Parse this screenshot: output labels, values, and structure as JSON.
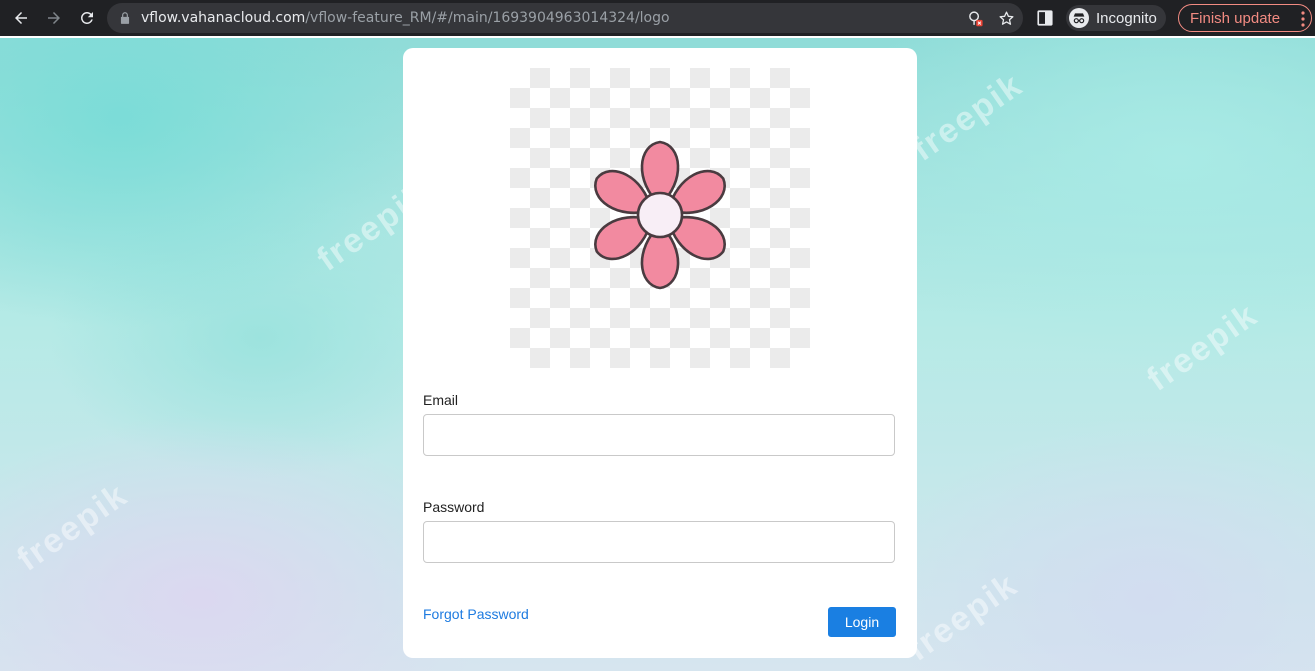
{
  "browser": {
    "url_host": "vflow.vahanacloud.com",
    "url_path": "/vflow-feature_RM/#/main/1693904963014324/logo",
    "profile_label": "Incognito",
    "update_label": "Finish update"
  },
  "background": {
    "watermark_text": "freepik"
  },
  "login": {
    "email_label": "Email",
    "email_value": "",
    "password_label": "Password",
    "password_value": "",
    "forgot_label": "Forgot Password",
    "login_label": "Login"
  },
  "icons": {
    "back": "arrow-left-icon",
    "forward": "arrow-right-icon",
    "reload": "reload-icon",
    "lock": "lock-icon",
    "blocked": "tracking-blocked-icon",
    "bookmark": "star-icon",
    "side_panel": "side-panel-icon",
    "incognito": "incognito-icon",
    "menu": "kebab-menu-icon",
    "logo": "flower-logo-icon"
  },
  "colors": {
    "chrome_bg": "#202124",
    "primary": "#1a7fe2",
    "link": "#1e7be0",
    "update_accent": "#f28b82",
    "petal": "#f28aa0"
  }
}
